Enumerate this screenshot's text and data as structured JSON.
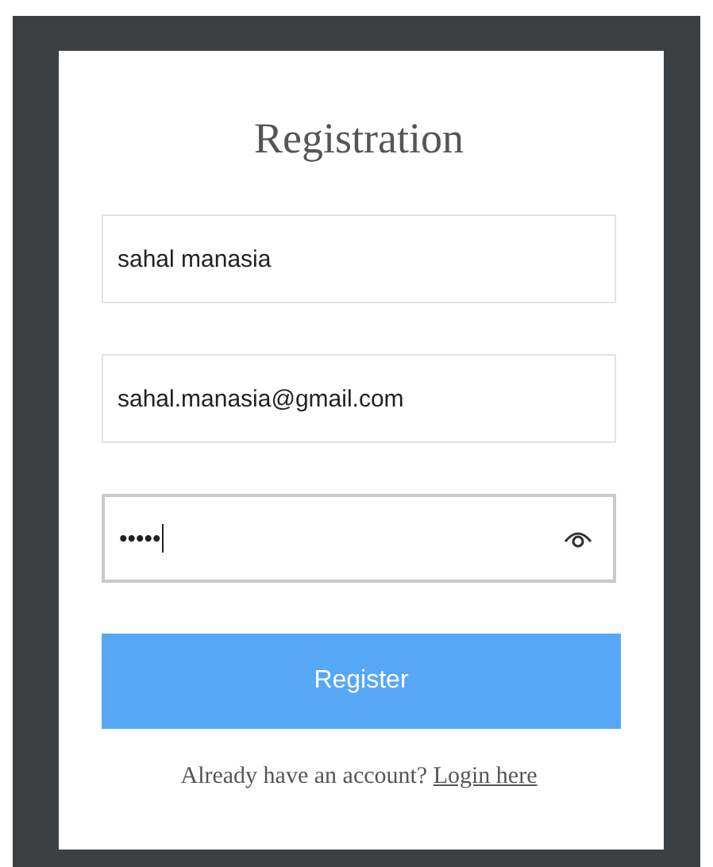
{
  "title": "Registration",
  "fields": [
    {
      "kind": "text",
      "value": "sahal manasia",
      "focused": false
    },
    {
      "kind": "text",
      "value": "sahal.manasia@gmail.com",
      "focused": false
    },
    {
      "kind": "password",
      "value": "•••••",
      "focused": true
    }
  ],
  "button": "Register",
  "footer": {
    "text": "Already have an account?",
    "link": "Login here"
  }
}
